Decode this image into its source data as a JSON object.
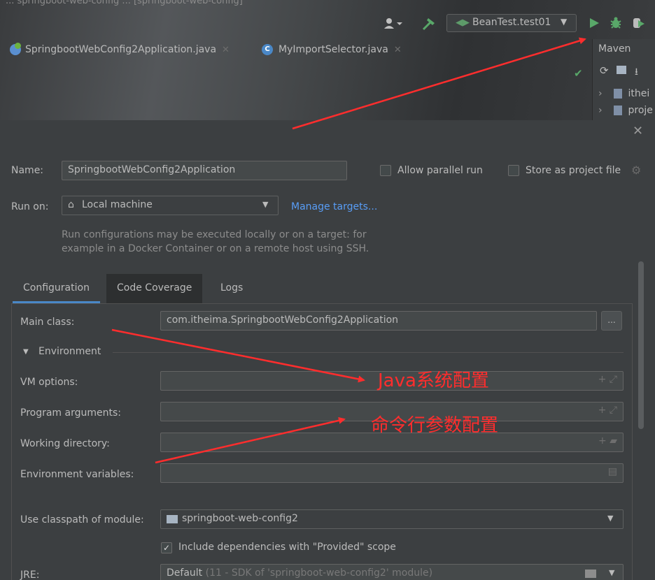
{
  "window": {
    "title": "... springboot-web-config ... [springboot-web-config]"
  },
  "toolbar": {
    "run_config_label": "BeanTest.test01"
  },
  "editor_tabs": [
    {
      "label": "SpringbootWebConfig2Application.java"
    },
    {
      "label": "MyImportSelector.java"
    }
  ],
  "maven": {
    "title": "Maven",
    "items": [
      "ithei",
      "proje"
    ]
  },
  "dialog": {
    "name_label": "Name:",
    "name_value": "SpringbootWebConfig2Application",
    "allow_parallel_label": "Allow parallel run",
    "store_as_project_label": "Store as project file",
    "run_on_label": "Run on:",
    "run_on_value": "Local machine",
    "manage_targets": "Manage targets...",
    "hint_line1": "Run configurations may be executed locally or on a target: for",
    "hint_line2": "example in a Docker Container or on a remote host using SSH.",
    "tabs": [
      "Configuration",
      "Code Coverage",
      "Logs"
    ],
    "main_class_label": "Main class:",
    "main_class_value": "com.itheima.SpringbootWebConfig2Application",
    "ellipsis": "...",
    "environment_label": "Environment",
    "vm_options_label": "VM options:",
    "program_args_label": "Program arguments:",
    "working_dir_label": "Working directory:",
    "env_vars_label": "Environment variables:",
    "classpath_label": "Use classpath of module:",
    "classpath_value": "springboot-web-config2",
    "include_deps_label": "Include dependencies with \"Provided\" scope",
    "jre_label": "JRE:",
    "jre_value_main": "Default",
    "jre_value_detail": "(11 - SDK of 'springboot-web-config2' module)"
  },
  "annotations": {
    "java_config": "Java系统配置",
    "cmd_config": "命令行参数配置",
    "color": "#ff2d2d"
  },
  "colors": {
    "accent": "#4a88c7",
    "run_green": "#59a869",
    "link": "#589df6"
  }
}
